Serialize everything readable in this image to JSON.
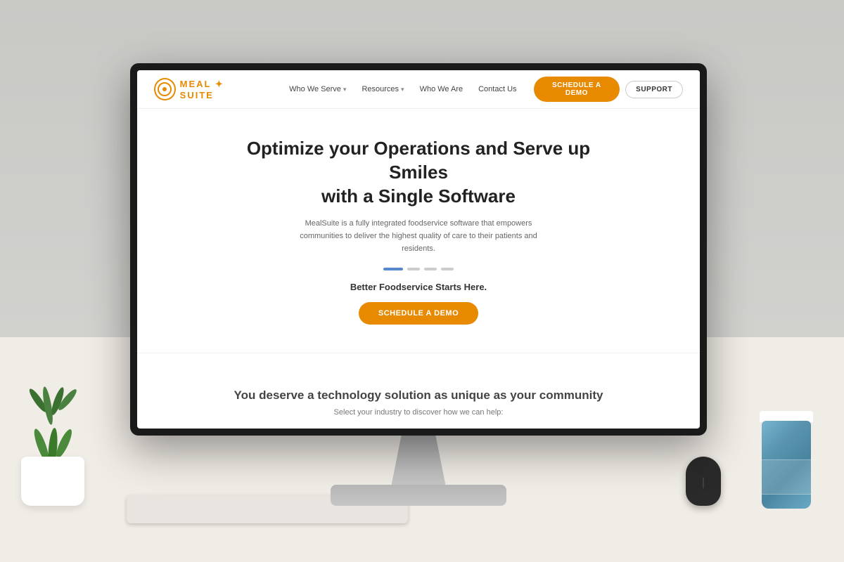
{
  "scene": {
    "background_wall_color": "#ccccca",
    "desk_color": "#f0ece6"
  },
  "website": {
    "navbar": {
      "logo_text_meal": "MEAL",
      "logo_text_suite": "SUITE",
      "nav_items": [
        {
          "label": "Who We Serve",
          "has_dropdown": true
        },
        {
          "label": "Resources",
          "has_dropdown": true
        },
        {
          "label": "Who We Are",
          "has_dropdown": false
        },
        {
          "label": "Contact Us",
          "has_dropdown": false
        }
      ],
      "btn_demo_label": "SCHEDULE A DEMO",
      "btn_support_label": "SUPPORT"
    },
    "hero": {
      "title_line1": "Optimize your Operations and Serve up Smiles",
      "title_line2": "with a Single Software",
      "subtitle": "MealSuite is a fully integrated foodservice software that empowers communities to deliver the highest quality of care to their patients and residents.",
      "slider_dots_count": 4,
      "slider_active_index": 0,
      "tagline": "Better Foodservice Starts Here.",
      "btn_demo_label": "SCHEDULE A DEMO"
    },
    "lower": {
      "title": "You deserve a technology solution as unique as your community",
      "subtitle": "Select your industry to discover how we can help:"
    }
  }
}
